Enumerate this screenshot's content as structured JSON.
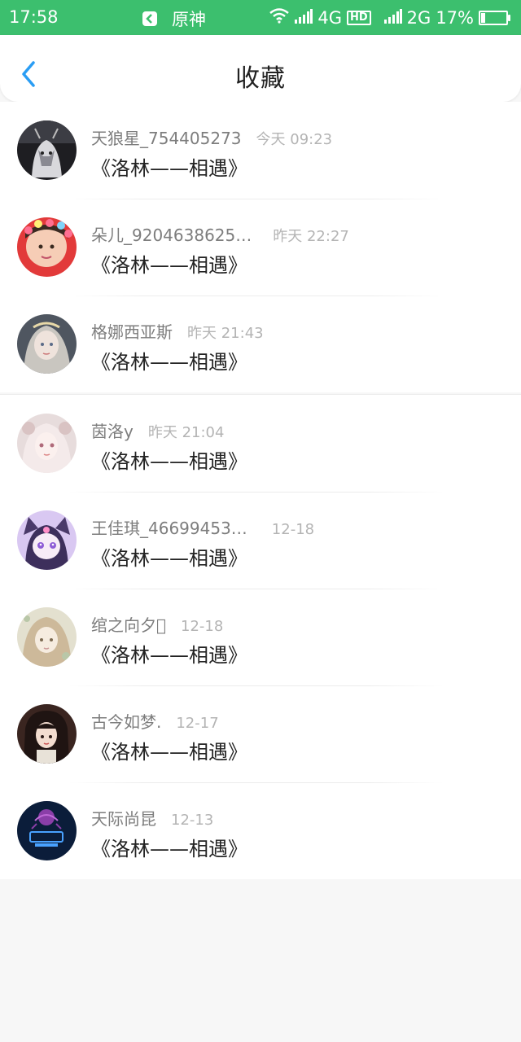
{
  "status_bar": {
    "time": "17:58",
    "app_name": "原神",
    "network_1": "4G",
    "hd": "HD",
    "network_2": "2G",
    "battery": "17%",
    "battery_level": 0.17
  },
  "header": {
    "title": "收藏",
    "back_icon": "chevron-left-icon"
  },
  "colors": {
    "status_bar": "#3cbf6e",
    "back_icon": "#2a9df4"
  },
  "favorites": [
    {
      "name": "天狼星_754405273",
      "time": "今天 09:23",
      "title": "《洛林——相遇》",
      "avatar": "avatar-dark"
    },
    {
      "name": "朵儿_9204638625…",
      "time": "昨天 22:27",
      "title": "《洛林——相遇》",
      "avatar": "avatar-girl"
    },
    {
      "name": "格娜西亚斯",
      "time": "昨天 21:43",
      "title": "《洛林——相遇》",
      "avatar": "avatar-anime-grey"
    },
    {
      "name": "茵洛y",
      "time": "昨天 21:04",
      "title": "《洛林——相遇》",
      "avatar": "avatar-anime-pink"
    },
    {
      "name": "王佳琪_46699453…",
      "time": "12-18",
      "title": "《洛林——相遇》",
      "avatar": "avatar-anime-purple"
    },
    {
      "name": "绾之向夕\u0000",
      "time": "12-18",
      "title": "《洛林——相遇》",
      "avatar": "avatar-anime-beige"
    },
    {
      "name": "古今如梦.",
      "time": "12-17",
      "title": "《洛林——相遇》",
      "avatar": "avatar-doll"
    },
    {
      "name": "天际尚昆",
      "time": "12-13",
      "title": "《洛林——相遇》",
      "avatar": "avatar-logo-blue"
    }
  ]
}
